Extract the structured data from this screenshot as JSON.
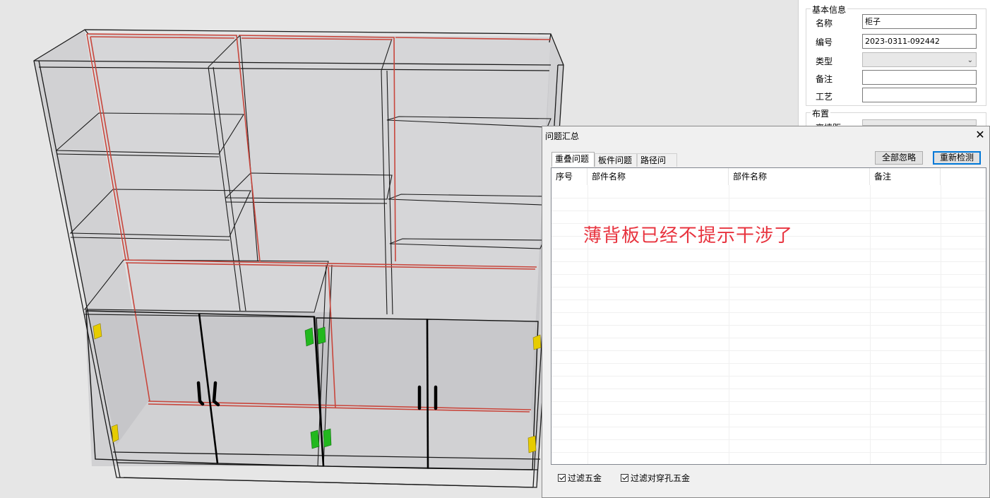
{
  "properties": {
    "basic_group_title": "基本信息",
    "fields": [
      {
        "label": "名称",
        "value": "柜子"
      },
      {
        "label": "编号",
        "value": "2023-0311-092442"
      },
      {
        "label": "类型",
        "value": ""
      },
      {
        "label": "备注",
        "value": ""
      },
      {
        "label": "工艺",
        "value": ""
      }
    ],
    "layout_group_title": "布置",
    "partial_label": "离墙距"
  },
  "dialog": {
    "title": "问题汇总",
    "tabs": [
      "重叠问题",
      "板件问题",
      "路径问题"
    ],
    "ignore_all_button": "全部忽略",
    "recheck_button": "重新检测",
    "columns": [
      "序号",
      "部件名称",
      "部件名称",
      "备注"
    ],
    "overlay_note": "薄背板已经不提示干涉了",
    "filter_hardware": "过滤五金",
    "filter_through_hole": "过滤对穿孔五金"
  },
  "colors": {
    "panel_edge_highlight": "#c8463c",
    "hinge_yellow": "#e6cc00",
    "hinge_green": "#22b81e",
    "note_red": "#e8343f",
    "accent_blue": "#0078d7"
  }
}
